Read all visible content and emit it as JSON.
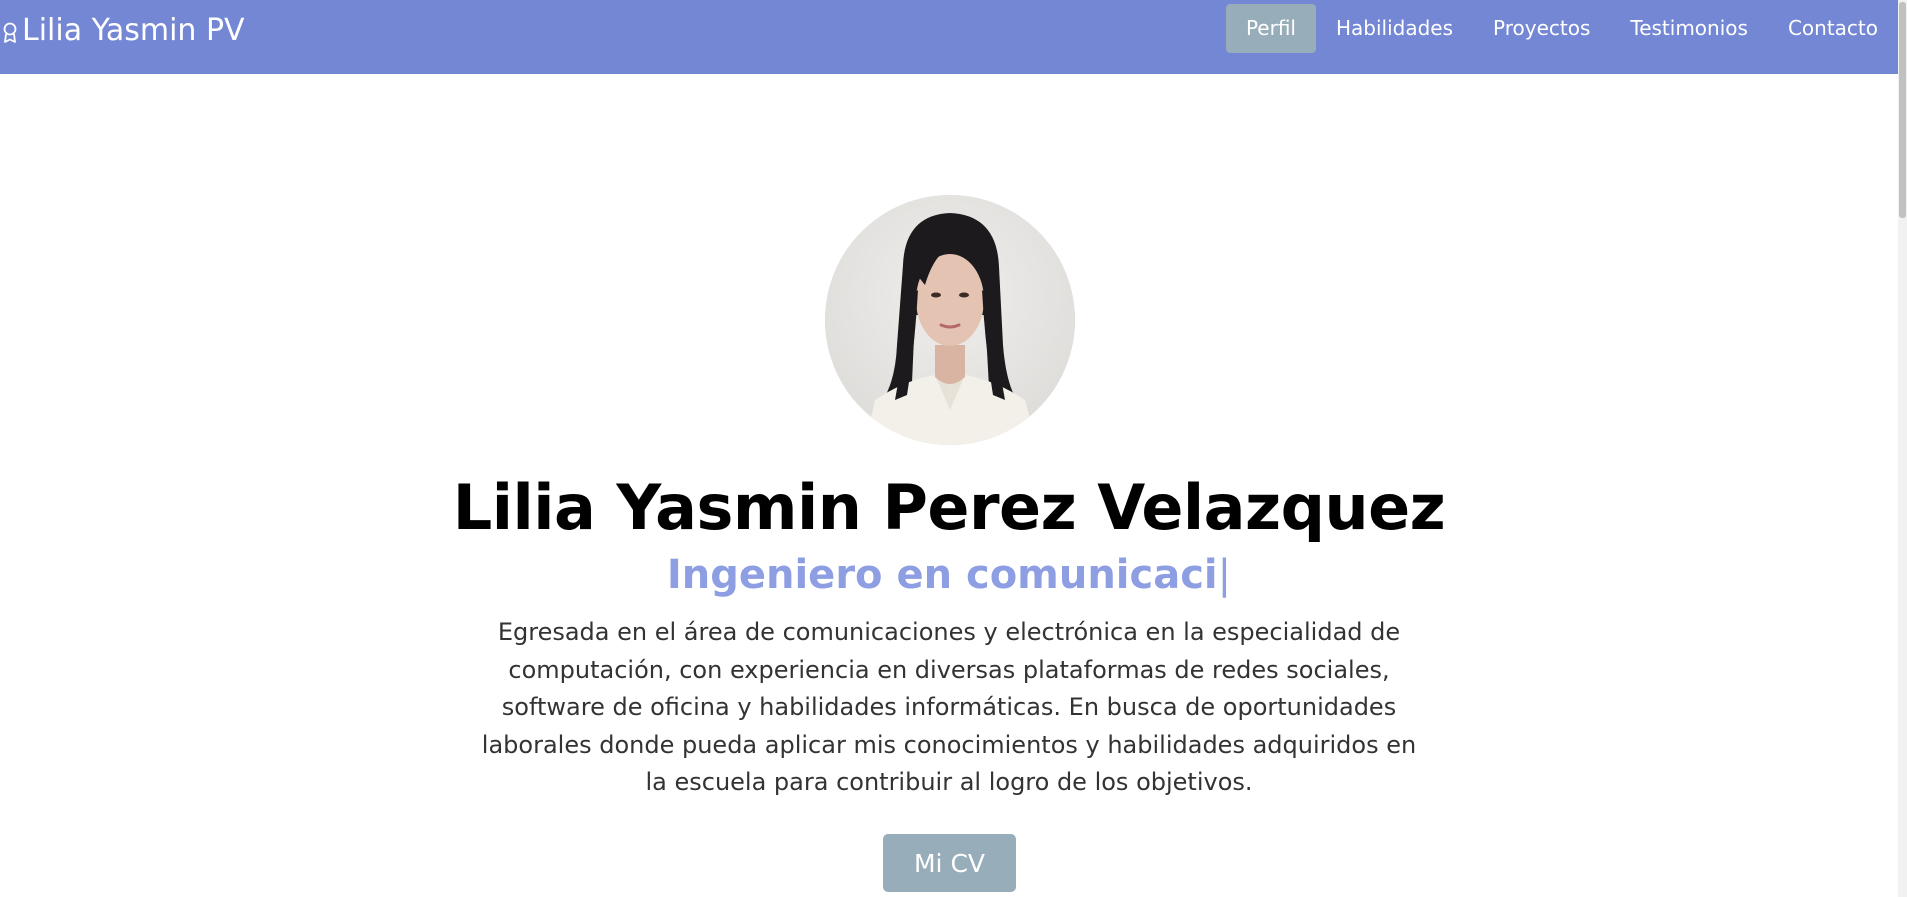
{
  "navbar": {
    "brand": "Lilia Yasmin PV",
    "brand_icon": "award-icon",
    "links": [
      {
        "label": "Perfil",
        "active": true
      },
      {
        "label": "Habilidades",
        "active": false
      },
      {
        "label": "Proyectos",
        "active": false
      },
      {
        "label": "Testimonios",
        "active": false
      },
      {
        "label": "Contacto",
        "active": false
      }
    ],
    "color": "#7387d4",
    "active_color": "#98adba"
  },
  "hero": {
    "avatar_alt": "profile-photo",
    "name": "Lilia Yasmin Perez Velazquez",
    "role": "Ingeniero en comunicaci",
    "role_cursor": "|",
    "role_color": "#8e9ee3",
    "description": "Egresada en el área de comunicaciones y electrónica en la especialidad de computación, con experiencia en diversas plataformas de redes sociales, software de oficina y habilidades informáticas. En busca de oportunidades laborales donde pueda aplicar mis conocimientos y habilidades adquiridos en la escuela para contribuir al logro de los objetivos.",
    "cv_button": "Mi CV"
  }
}
